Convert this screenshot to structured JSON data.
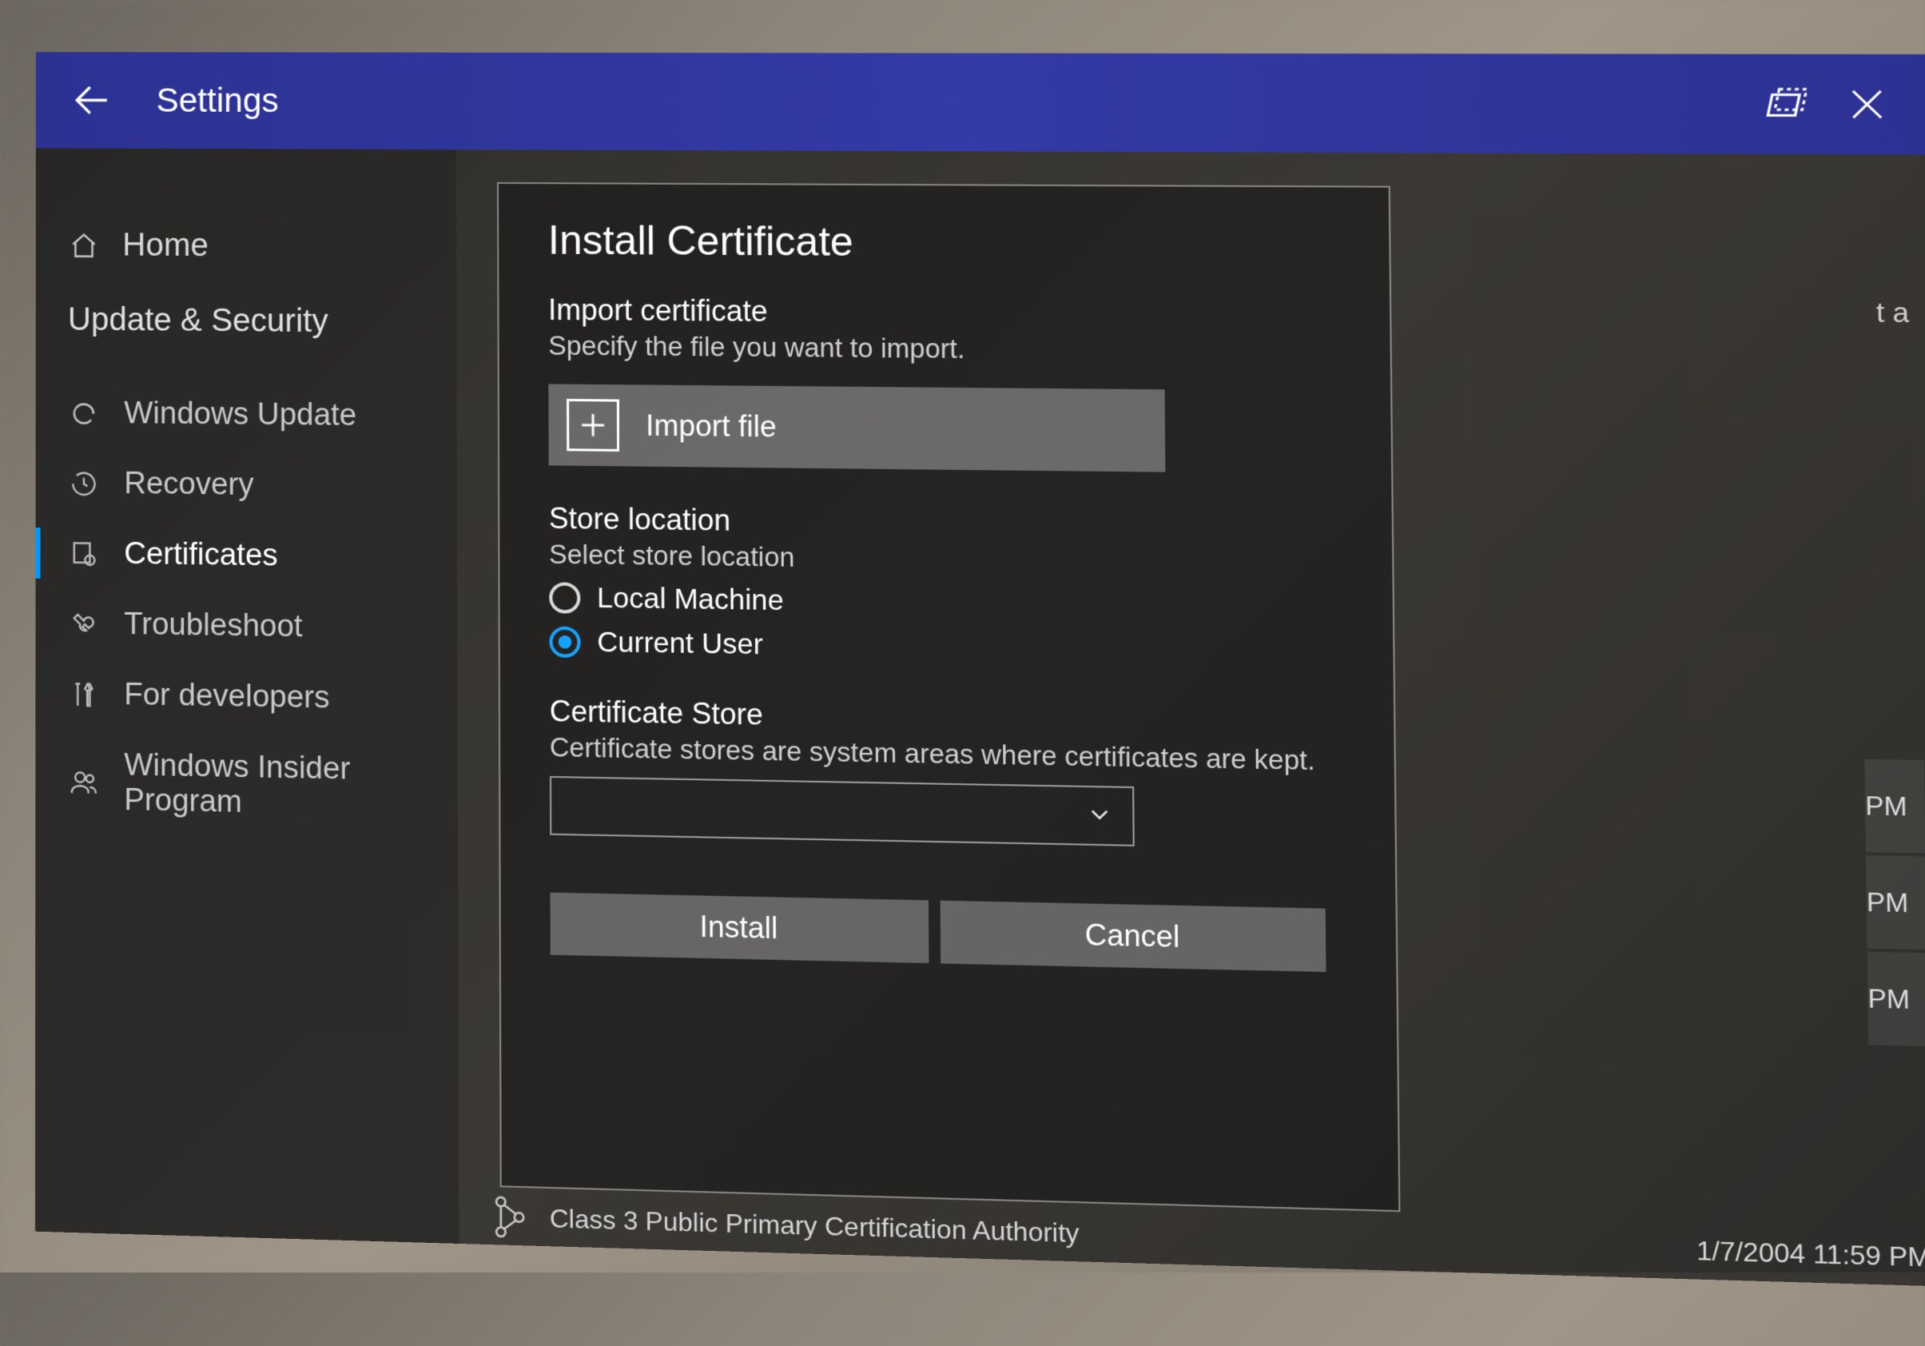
{
  "header": {
    "title": "Settings"
  },
  "sidebar": {
    "home_label": "Home",
    "section_label": "Update & Security",
    "items": [
      {
        "label": "Windows Update"
      },
      {
        "label": "Recovery"
      },
      {
        "label": "Certificates"
      },
      {
        "label": "Troubleshoot"
      },
      {
        "label": "For developers"
      },
      {
        "label": "Windows Insider Program"
      }
    ]
  },
  "dialog": {
    "title": "Install Certificate",
    "import_label": "Import certificate",
    "import_sub": "Specify the file you want to import.",
    "import_button": "Import file",
    "store_loc_label": "Store location",
    "store_loc_sub": "Select store location",
    "radio_local": "Local Machine",
    "radio_user": "Current User",
    "cert_store_label": "Certificate Store",
    "cert_store_sub": "Certificate stores are system areas where certificates are kept.",
    "install_btn": "Install",
    "cancel_btn": "Cancel"
  },
  "background": {
    "partial_text": "t a",
    "pm1": "PM",
    "pm2": "PM",
    "pm3": "PM",
    "cert_name": "Class 3 Public Primary Certification Authority",
    "cert_date": "1/7/2004 11:59 PM"
  }
}
